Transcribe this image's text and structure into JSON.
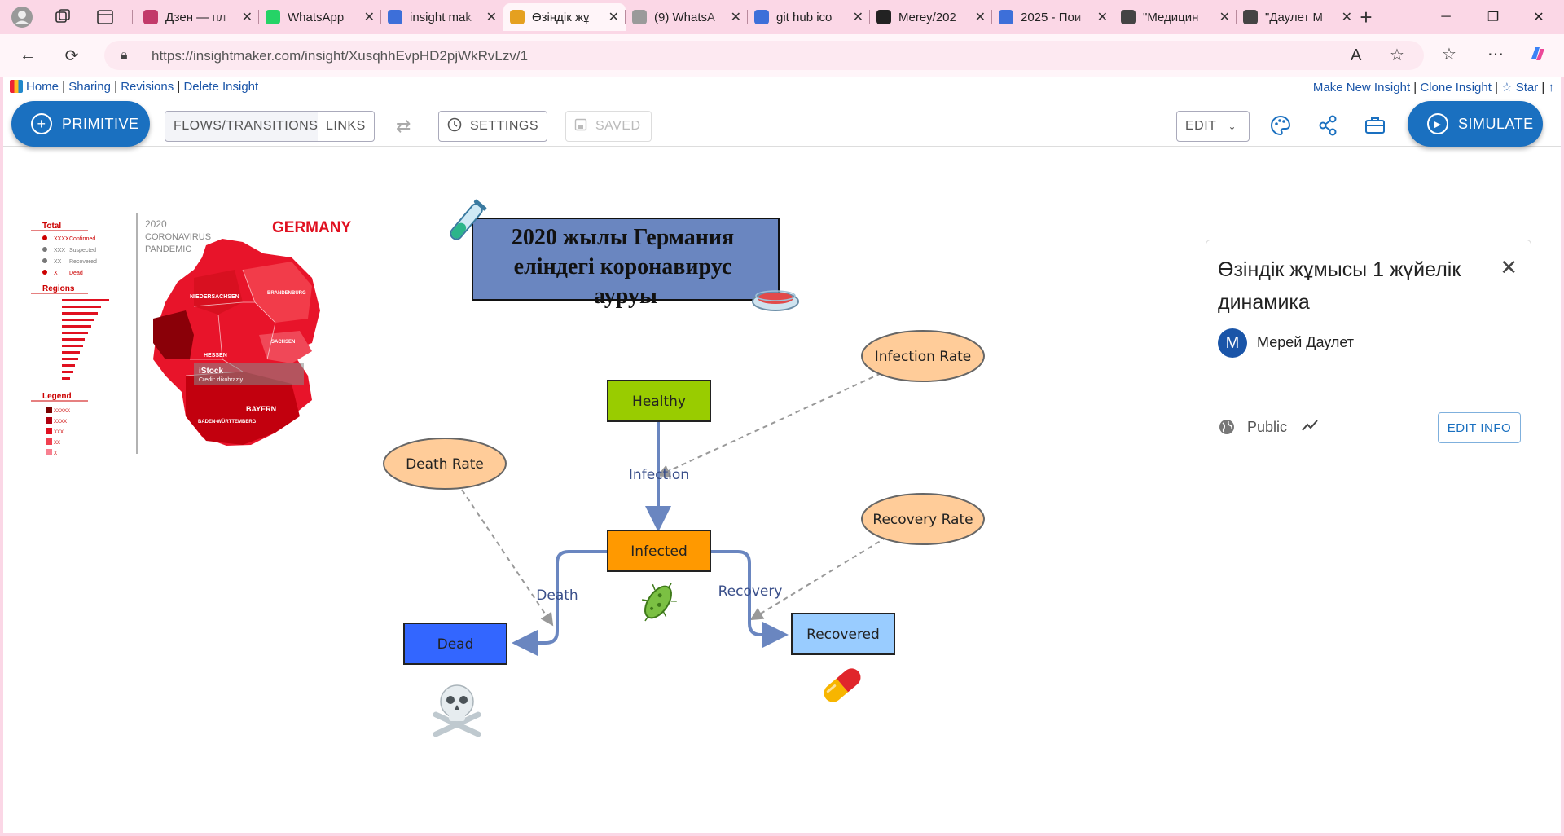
{
  "browser": {
    "tabs": [
      {
        "title": "Дзен — пл",
        "active": false,
        "icon": "sparkle-icon",
        "color": "#c23a6a"
      },
      {
        "title": "WhatsApp",
        "active": false,
        "icon": "whatsapp-icon",
        "color": "#25d366"
      },
      {
        "title": "insight mak",
        "active": false,
        "icon": "search-icon",
        "color": "#3d6fd9"
      },
      {
        "title": "Өзіндік жұ",
        "active": true,
        "icon": "insightmaker-icon",
        "color": "#e5a020"
      },
      {
        "title": "(9) WhatsA",
        "active": false,
        "icon": "whatsapp-icon",
        "color": "#9a9a9a"
      },
      {
        "title": "git hub ico",
        "active": false,
        "icon": "search-icon",
        "color": "#3d6fd9"
      },
      {
        "title": "Merey/202",
        "active": false,
        "icon": "github-icon",
        "color": "#222222"
      },
      {
        "title": "2025 - Пои",
        "active": false,
        "icon": "search-icon",
        "color": "#3d6fd9"
      },
      {
        "title": "\"Медицин",
        "active": false,
        "icon": "globe-icon",
        "color": "#444444"
      },
      {
        "title": "\"Даулет М",
        "active": false,
        "icon": "globe-icon",
        "color": "#444444"
      }
    ],
    "url_domain": "https://insightmaker.com",
    "url_path": "/insight/XusqhhEvpHD2pjWkRvLzv/1"
  },
  "top_links": {
    "left": [
      "Home",
      "Sharing",
      "Revisions",
      "Delete Insight"
    ],
    "right": [
      "Make New Insight",
      "Clone Insight",
      "☆ Star",
      "↑"
    ]
  },
  "toolbar": {
    "primitive": "PRIMITIVE",
    "flows": "FLOWS/TRANSITIONS",
    "links": "LINKS",
    "settings": "SETTINGS",
    "saved": "SAVED",
    "edit": "EDIT",
    "simulate": "SIMULATE"
  },
  "diagram": {
    "title": "2020 жылы Германия еліндегі коронавирус ауруы",
    "title_lines": [
      "2020 жылы Германия",
      "еліндегі коронавирус",
      "ауруы"
    ],
    "stocks": {
      "healthy": "Healthy",
      "infected": "Infected",
      "dead": "Dead",
      "recovered": "Recovered"
    },
    "variables": {
      "infection_rate": "Infection Rate",
      "death_rate": "Death Rate",
      "recovery_rate": "Recovery Rate"
    },
    "flows": {
      "infection": "Infection",
      "death": "Death",
      "recovery": "Recovery"
    },
    "colors": {
      "healthy": "#99cc00",
      "infected": "#ff9900",
      "dead": "#3366ff",
      "recovered": "#99ccff",
      "variable": "#ffcc99",
      "flow": "#6a86c0",
      "title_box": "#6a86c0"
    }
  },
  "infographic": {
    "year": "2020",
    "subtitle_1": "CORONAVIRUS",
    "subtitle_2": "PANDEMIC",
    "country": "GERMANY",
    "total_label": "Total",
    "legend_rows": [
      {
        "code": "XXXX",
        "label": "Confirmed"
      },
      {
        "code": "XXX",
        "label": "Suspected"
      },
      {
        "code": "XX",
        "label": "Recovered"
      },
      {
        "code": "X",
        "label": "Dead"
      }
    ],
    "regions_label": "Regions",
    "legend_label": "Legend",
    "legend_scale": [
      "XXXXX",
      "XXXX",
      "XXX",
      "XX",
      "X"
    ],
    "states": [
      "NIEDERSACHSEN",
      "HESSEN",
      "BAYERN",
      "BADEN-WÜRTTEMBERG",
      "SACHSEN",
      "BRANDENBURG"
    ],
    "watermark_title": "iStock",
    "watermark_credit": "Credit: dikobraziy"
  },
  "panel": {
    "title": "Өзіндік жұмысы 1 жүйелік динамика",
    "author_initial": "M",
    "author": "Мерей Даулет",
    "visibility": "Public",
    "edit_info": "EDIT INFO"
  }
}
